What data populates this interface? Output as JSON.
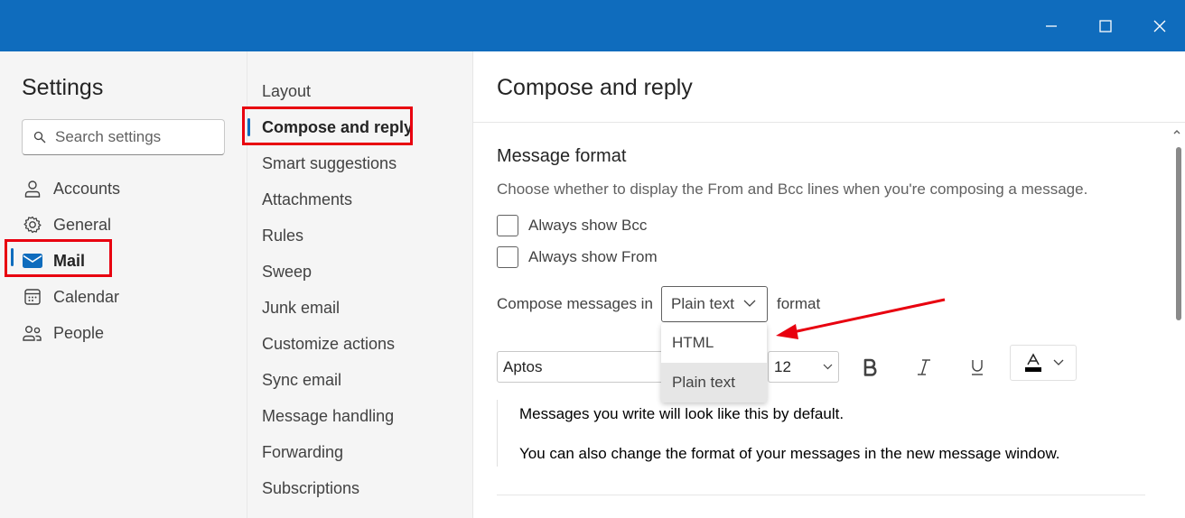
{
  "window": {
    "controls": [
      "minimize-icon",
      "maximize-icon",
      "close-icon"
    ],
    "accent": "#0f6cbd"
  },
  "left": {
    "title": "Settings",
    "search_placeholder": "Search settings",
    "items": [
      {
        "label": "Accounts",
        "icon": "person-icon"
      },
      {
        "label": "General",
        "icon": "gear-icon"
      },
      {
        "label": "Mail",
        "icon": "mail-icon",
        "active": true
      },
      {
        "label": "Calendar",
        "icon": "calendar-icon"
      },
      {
        "label": "People",
        "icon": "people-icon"
      }
    ]
  },
  "middle": {
    "items": [
      {
        "label": "Layout"
      },
      {
        "label": "Compose and reply",
        "active": true
      },
      {
        "label": "Smart suggestions"
      },
      {
        "label": "Attachments"
      },
      {
        "label": "Rules"
      },
      {
        "label": "Sweep"
      },
      {
        "label": "Junk email"
      },
      {
        "label": "Customize actions"
      },
      {
        "label": "Sync email"
      },
      {
        "label": "Message handling"
      },
      {
        "label": "Forwarding"
      },
      {
        "label": "Subscriptions"
      }
    ]
  },
  "main": {
    "title": "Compose and reply",
    "section": {
      "title": "Message format",
      "description": "Choose whether to display the From and Bcc lines when you're composing a message.",
      "checkboxes": [
        {
          "label": "Always show Bcc",
          "checked": false
        },
        {
          "label": "Always show From",
          "checked": false
        }
      ],
      "compose_label": "Compose messages in",
      "compose_value": "Plain text",
      "compose_suffix": "format",
      "dropdown_options": [
        "HTML",
        "Plain text"
      ],
      "highlighted_option": "Plain text",
      "font": "Aptos",
      "font_size": "12",
      "format_buttons": [
        "bold-icon",
        "italic-icon",
        "underline-icon"
      ],
      "preview_lines": [
        "Messages you write will look like this by default.",
        "You can also change the format of your messages in the new message window."
      ]
    }
  },
  "annotations": {
    "highlight_color": "#e8000f"
  }
}
